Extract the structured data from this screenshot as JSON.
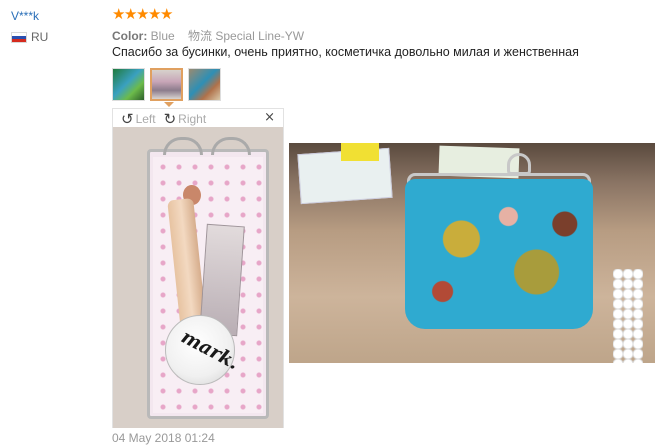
{
  "review": {
    "user": {
      "name": "V***k",
      "country_code": "RU",
      "flag_icon": "russia-flag-icon"
    },
    "rating": {
      "stars": 5,
      "max": 5,
      "star_symbol": "★",
      "color": "#ff8a00"
    },
    "color_label": "Color:",
    "color_value": "Blue",
    "shipping": "物流 Special Line-YW",
    "text": "Спасибо за бусинки, очень приятно, косметичка довольно милая и женственная",
    "thumbnails": [
      {
        "name": "review-photo-thumb-1",
        "icon": "photo-thumbnail"
      },
      {
        "name": "review-photo-thumb-2",
        "icon": "photo-thumbnail",
        "active": true
      },
      {
        "name": "review-photo-thumb-3",
        "icon": "photo-thumbnail"
      }
    ],
    "viewer": {
      "rotate_left_label": "Left",
      "rotate_right_label": "Right",
      "rotate_left_icon": "↺",
      "rotate_right_icon": "↻",
      "close_icon": "×",
      "compact_text": "mark."
    },
    "date": "04 May 2018 01:24"
  }
}
